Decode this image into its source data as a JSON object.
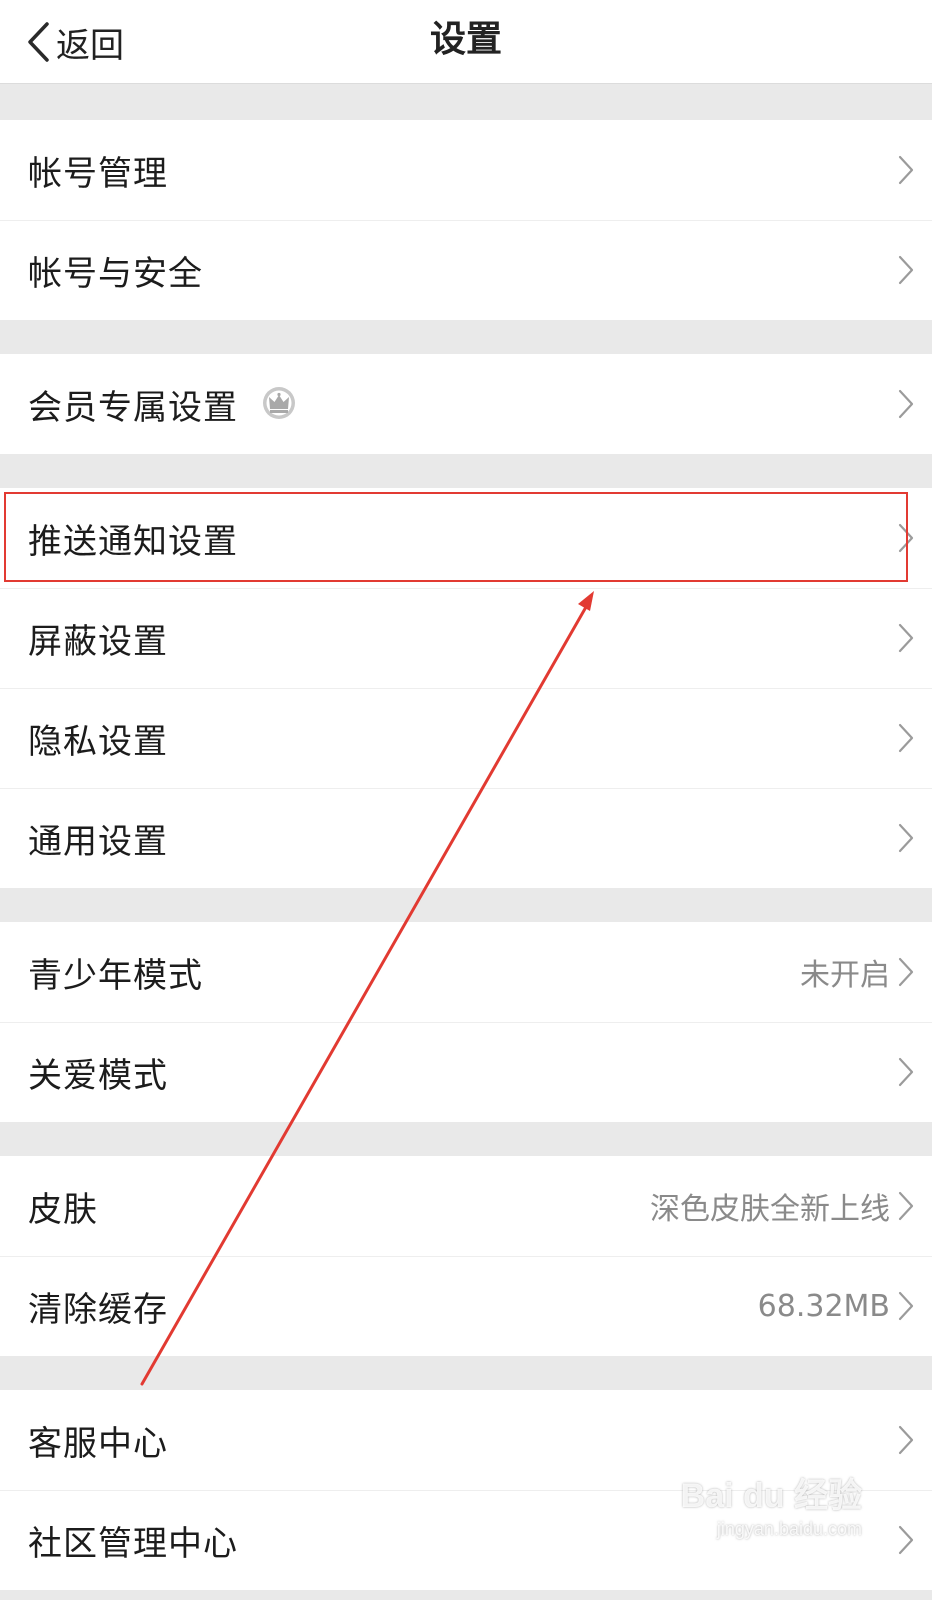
{
  "nav": {
    "back_label": "返回",
    "title": "设置"
  },
  "groups": [
    {
      "items": [
        {
          "label": "帐号管理"
        },
        {
          "label": "帐号与安全"
        }
      ]
    },
    {
      "items": [
        {
          "label": "会员专属设置",
          "icon": "crown-icon"
        }
      ]
    },
    {
      "items": [
        {
          "label": "推送通知设置",
          "highlighted": true
        },
        {
          "label": "屏蔽设置"
        },
        {
          "label": "隐私设置"
        },
        {
          "label": "通用设置"
        }
      ]
    },
    {
      "items": [
        {
          "label": "青少年模式",
          "value": "未开启"
        },
        {
          "label": "关爱模式"
        }
      ]
    },
    {
      "items": [
        {
          "label": "皮肤",
          "value": "深色皮肤全新上线"
        },
        {
          "label": "清除缓存",
          "value": "68.32MB"
        }
      ]
    },
    {
      "items": [
        {
          "label": "客服中心"
        },
        {
          "label": "社区管理中心"
        }
      ]
    }
  ],
  "annotation": {
    "highlight_color": "#e23a32",
    "arrow_color": "#e23a32"
  },
  "watermark": {
    "main": "Bai du 经验",
    "sub": "jingyan.baidu.com"
  }
}
